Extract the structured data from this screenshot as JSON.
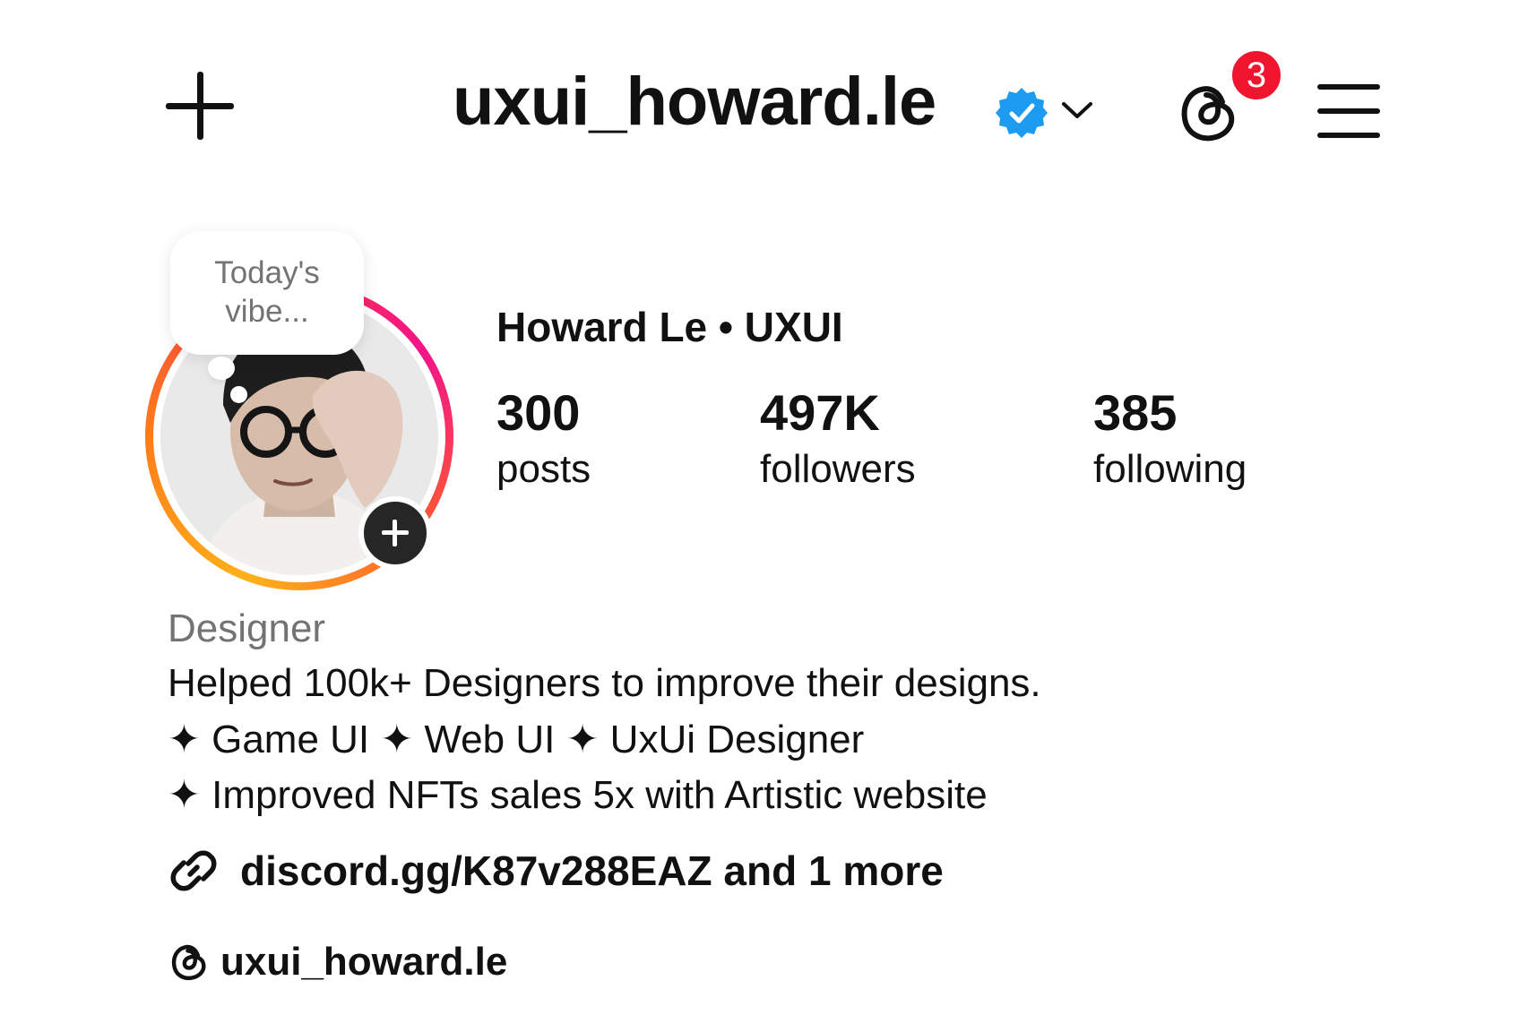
{
  "header": {
    "username": "uxui_howard.le",
    "notification_count": "3"
  },
  "profile": {
    "note": {
      "line1": "Today's",
      "line2": "vibe..."
    },
    "display_name": "Howard Le • UXUI",
    "stats": [
      {
        "value": "300",
        "label": "posts"
      },
      {
        "value": "497K",
        "label": "followers"
      },
      {
        "value": "385",
        "label": "following"
      }
    ]
  },
  "bio": {
    "category": "Designer",
    "lines": [
      "Helped 100k+ Designers to improve their designs.",
      "✦ Game UI ✦ Web UI ✦ UxUi Designer",
      "✦ Improved NFTs sales 5x with Artistic website"
    ],
    "link_text": "discord.gg/K87v288EAZ and 1 more",
    "threads_handle": "uxui_howard.le"
  },
  "colors": {
    "verified": "#1d9bf0",
    "badge": "#f0142f",
    "secondary_text": "#737373",
    "add_story": "#262626"
  },
  "icons": [
    "plus-icon",
    "verified-badge-icon",
    "chevron-down-icon",
    "threads-icon",
    "hamburger-menu-icon",
    "add-story-icon",
    "link-icon"
  ]
}
